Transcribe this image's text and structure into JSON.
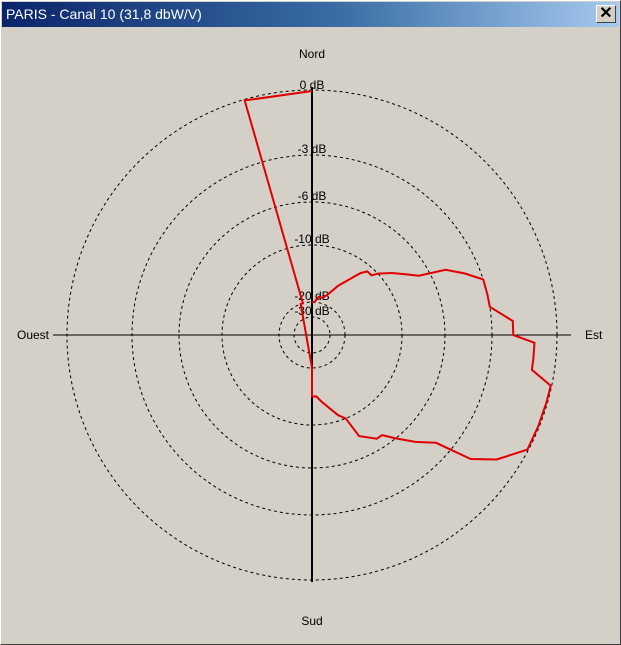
{
  "window": {
    "title": "PARIS - Canal 10 (31,8 dbW/V)",
    "close_symbol": "✕"
  },
  "colors": {
    "background": "#d4d0c8",
    "pattern": "#e00000",
    "grid": "#000000"
  },
  "chart_data": {
    "type": "polar",
    "title": "",
    "directions": {
      "north": "Nord",
      "south": "Sud",
      "east": "Est",
      "west": "Ouest"
    },
    "radial_unit": "dB",
    "rings": [
      {
        "value": 0,
        "label": "0 dB"
      },
      {
        "value": -3,
        "label": "-3 dB"
      },
      {
        "value": -6,
        "label": "-6 dB"
      },
      {
        "value": -10,
        "label": "-10 dB"
      },
      {
        "value": -20,
        "label": "-20 dB"
      },
      {
        "value": -30,
        "label": "-30 dB"
      }
    ],
    "outer_ring_db": 1.2,
    "grid": "dashed circles",
    "series": [
      {
        "color": "#e00000",
        "points": [
          {
            "azimuth": 0,
            "db": 0
          },
          {
            "azimuth": 344,
            "db": 0
          },
          {
            "azimuth": 344,
            "db": -20
          },
          {
            "azimuth": 340,
            "db": -20
          },
          {
            "azimuth": 180,
            "db": -20
          },
          {
            "azimuth": 180,
            "db": -15
          },
          {
            "azimuth": 176,
            "db": -15
          },
          {
            "azimuth": 172,
            "db": -14
          },
          {
            "azimuth": 168,
            "db": -13
          },
          {
            "azimuth": 162,
            "db": -11
          },
          {
            "azimuth": 158,
            "db": -10
          },
          {
            "azimuth": 155,
            "db": -8
          },
          {
            "azimuth": 148,
            "db": -7
          },
          {
            "azimuth": 145,
            "db": -7
          },
          {
            "azimuth": 141,
            "db": -6
          },
          {
            "azimuth": 136,
            "db": -5
          },
          {
            "azimuth": 131,
            "db": -4
          },
          {
            "azimuth": 128,
            "db": -2
          },
          {
            "azimuth": 124,
            "db": -1
          },
          {
            "azimuth": 118,
            "db": 0
          },
          {
            "azimuth": 112,
            "db": 0
          },
          {
            "azimuth": 106,
            "db": 0
          },
          {
            "azimuth": 102,
            "db": 0
          },
          {
            "azimuth": 99,
            "db": -1
          },
          {
            "azimuth": 96,
            "db": -1
          },
          {
            "azimuth": 92,
            "db": -1
          },
          {
            "azimuth": 90,
            "db": -2
          },
          {
            "azimuth": 86,
            "db": -2
          },
          {
            "azimuth": 81,
            "db": -3
          },
          {
            "azimuth": 77,
            "db": -3
          },
          {
            "azimuth": 72,
            "db": -3
          },
          {
            "azimuth": 68,
            "db": -4
          },
          {
            "azimuth": 64,
            "db": -5
          },
          {
            "azimuth": 61,
            "db": -7
          },
          {
            "azimuth": 57,
            "db": -8
          },
          {
            "azimuth": 52,
            "db": -9
          },
          {
            "azimuth": 47,
            "db": -10
          },
          {
            "azimuth": 45,
            "db": -11
          },
          {
            "azimuth": 41,
            "db": -11
          },
          {
            "azimuth": 38,
            "db": -12
          },
          {
            "azimuth": 34,
            "db": -14
          },
          {
            "azimuth": 28,
            "db": -16
          },
          {
            "azimuth": 22,
            "db": -18
          },
          {
            "azimuth": 16,
            "db": -19
          },
          {
            "azimuth": 10,
            "db": -19
          },
          {
            "azimuth": 4,
            "db": -20
          },
          {
            "azimuth": 0,
            "db": -20
          }
        ]
      }
    ]
  }
}
